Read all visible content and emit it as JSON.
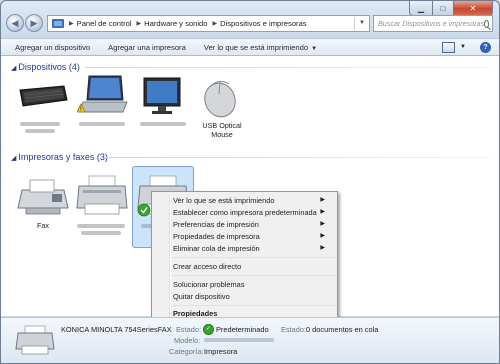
{
  "address": {
    "breadcrumbs": [
      "Panel de control",
      "Hardware y sonido",
      "Dispositivos e impresoras"
    ],
    "search_placeholder": "Buscar Dispositivos e impresoras"
  },
  "toolbar": {
    "add_device": "Agregar un dispositivo",
    "add_printer": "Agregar una impresora",
    "see_printing": "Ver lo que se está imprimiendo"
  },
  "groups": {
    "devices": "Dispositivos (4)",
    "printers": "Impresoras y faxes (3)"
  },
  "devices": {
    "mouse_label_1": "USB Optical",
    "mouse_label_2": "Mouse"
  },
  "printers": {
    "fax_label": "Fax"
  },
  "context_menu": {
    "items": [
      "Ver lo que se está imprimiendo",
      "Establecer como impresora predeterminada",
      "Preferencias de impresión",
      "Propiedades de impresora",
      "Eliminar cola de impresión",
      "Crear acceso directo",
      "Solucionar problemas",
      "Quitar dispositivo",
      "Propiedades"
    ]
  },
  "details": {
    "name": "KONICA MINOLTA 754SeriesFAX",
    "status_key": "Estado:",
    "status_value": "Predeterminado",
    "status2_key": "Estado:",
    "status2_value": "0 documentos en cola",
    "model_key": "Modelo:",
    "category_key": "Categoría:",
    "category_value": "Impresora"
  },
  "colors": {
    "group_header": "#1f3d8c",
    "selection": "#cce4f7",
    "ok_badge": "#3aa52e"
  }
}
